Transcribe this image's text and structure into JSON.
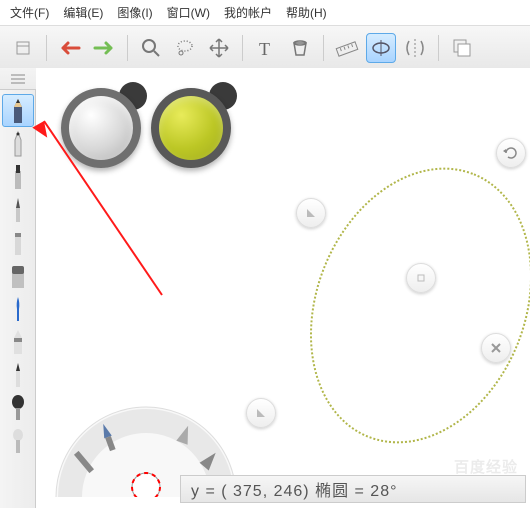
{
  "menu": {
    "file": "文件(F)",
    "edit": "编辑(E)",
    "image": "图像(I)",
    "window": "窗口(W)",
    "account": "我的帐户",
    "help": "帮助(H)"
  },
  "status": {
    "expr": "y = (   375,    246) 椭圆  =  28°"
  },
  "watermark": "百度经验",
  "colors": {
    "accent": "#a9d4ff",
    "ellipse": "#b1b64a",
    "undo": "#d94c3a",
    "redo": "#74be54"
  }
}
